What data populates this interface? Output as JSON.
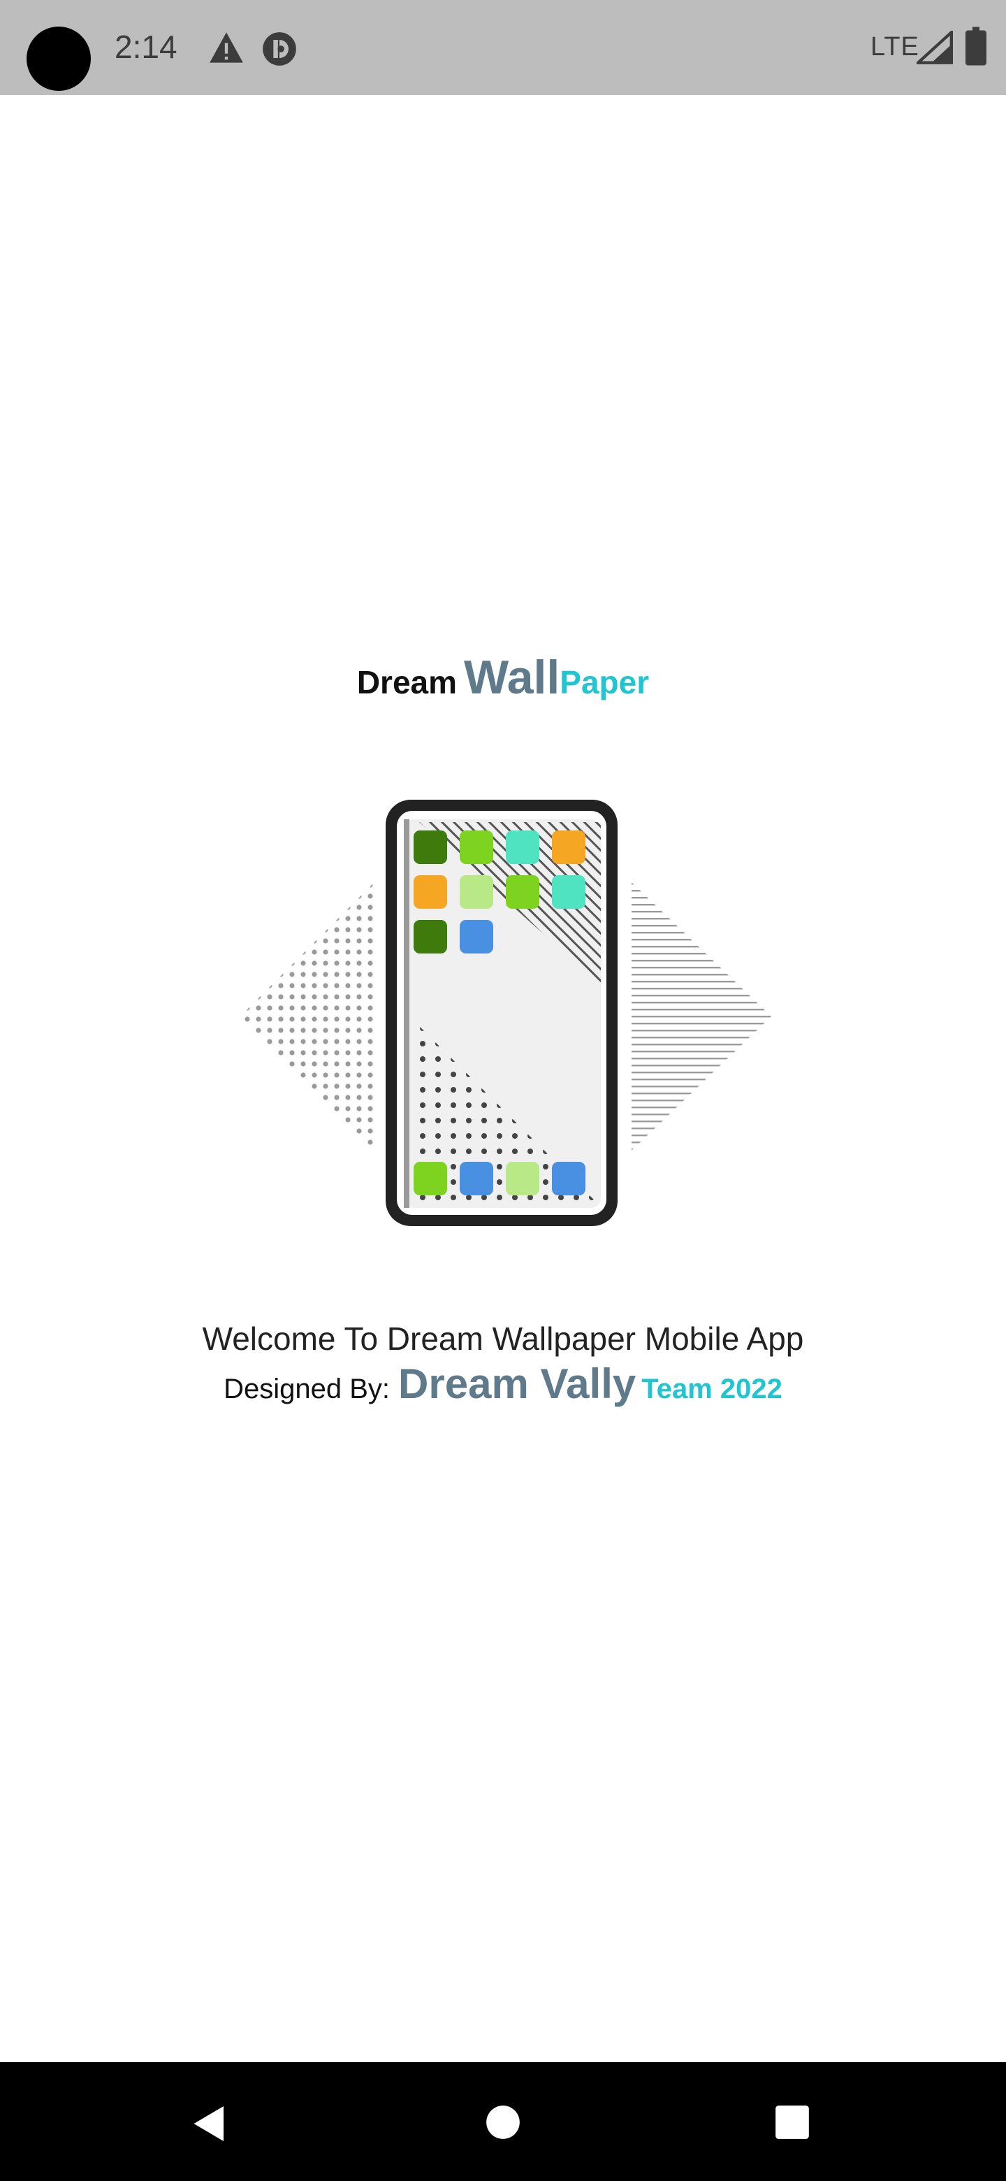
{
  "status_bar": {
    "time": "2:14",
    "network": "LTE",
    "icons": [
      "warning-icon",
      "app-notification-icon",
      "signal-icon",
      "battery-icon"
    ]
  },
  "splash": {
    "title": {
      "part1": "Dream",
      "part2": "Wall",
      "part3": "Paper"
    },
    "welcome_text": "Welcome To Dream Wallpaper Mobile App",
    "credits": {
      "prefix": "Designed By:",
      "name": "Dream Vally",
      "suffix": "Team 2022"
    }
  },
  "colors": {
    "accent_cyan": "#1fc5d0",
    "slate": "#5f7a8a",
    "tile_dark_green": "#3f7a0c",
    "tile_green": "#7ed321",
    "tile_light_green": "#b8e986",
    "tile_teal": "#50e3c2",
    "tile_orange": "#f5a623",
    "tile_blue": "#4a90e2"
  },
  "navigation": {
    "buttons": [
      "back-button",
      "home-button",
      "recents-button"
    ]
  }
}
